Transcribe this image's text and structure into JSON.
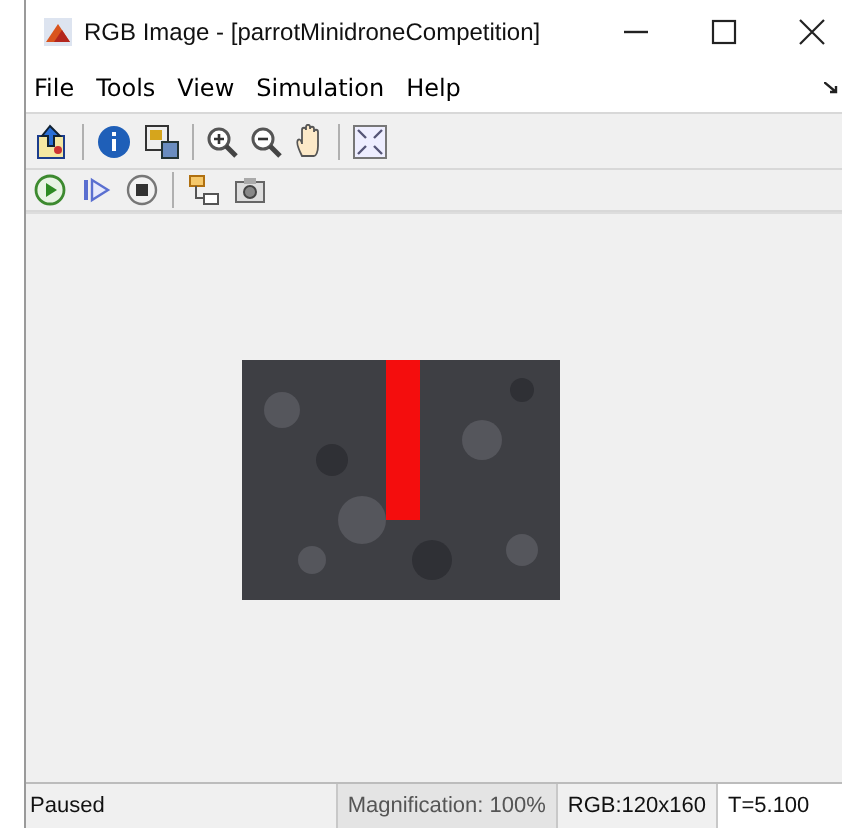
{
  "window": {
    "title": "RGB Image - [parrotMinidroneCompetition]"
  },
  "menu": [
    "File",
    "Tools",
    "View",
    "Simulation",
    "Help"
  ],
  "status_bar": {
    "status": "Paused",
    "magnification": "Magnification: 100%",
    "size": "RGB:120x160",
    "time": "T=5.100"
  }
}
